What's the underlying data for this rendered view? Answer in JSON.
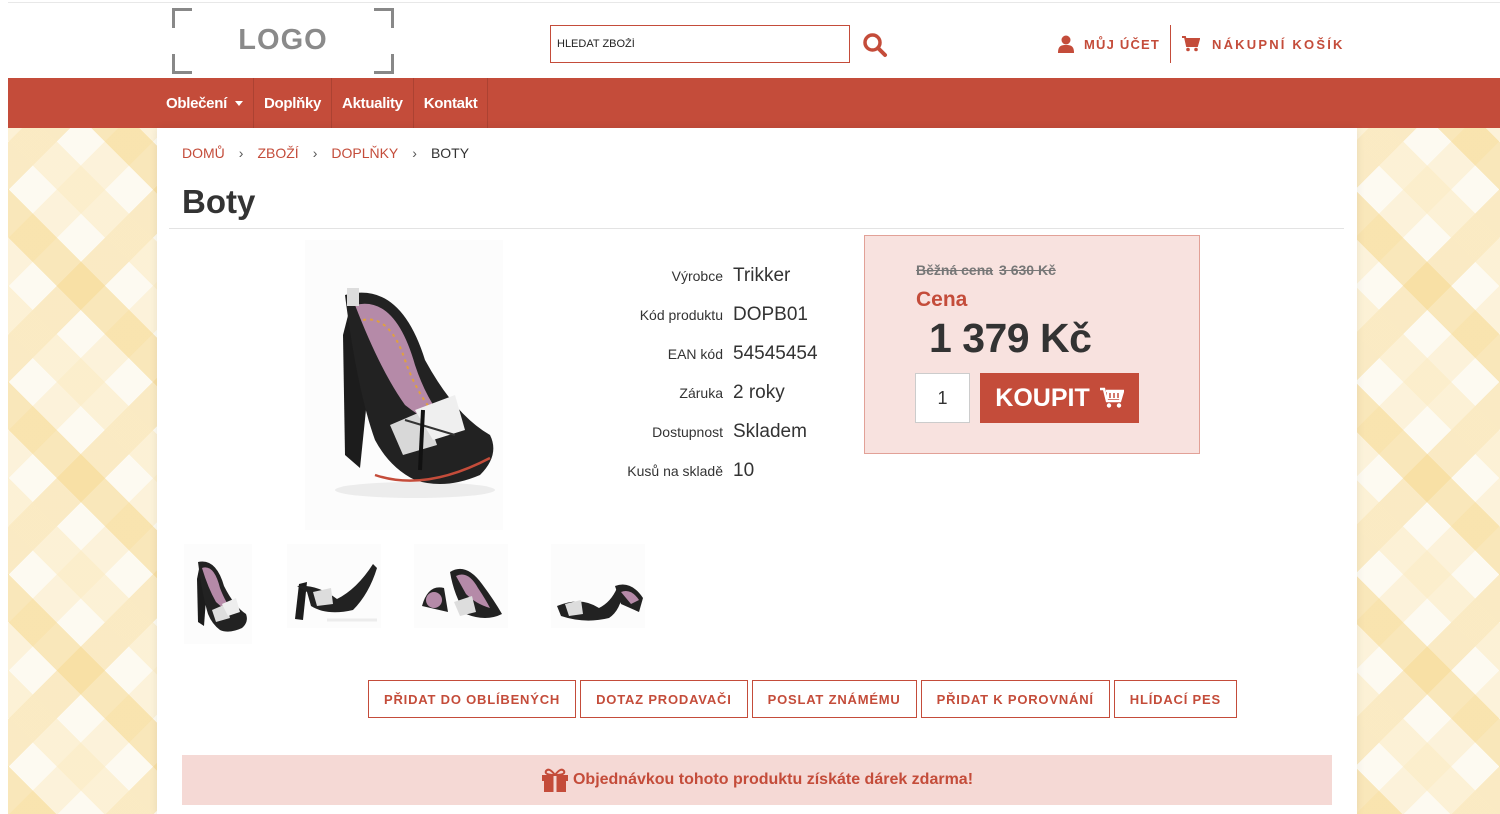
{
  "header": {
    "logo_text": "LOGO",
    "search_placeholder": "HLEDAT ZBOŽÍ",
    "account_label": "MŮJ ÚČET",
    "cart_label": "NÁKUPNÍ KOŠÍK"
  },
  "nav": {
    "items": [
      {
        "label": "Oblečení",
        "has_dropdown": true
      },
      {
        "label": "Doplňky"
      },
      {
        "label": "Aktuality"
      },
      {
        "label": "Kontakt"
      }
    ]
  },
  "breadcrumb": [
    "DOMŮ",
    "ZBOŽÍ",
    "DOPLŇKY",
    "BOTY"
  ],
  "product": {
    "title": "Boty",
    "specs": [
      {
        "label": "Výrobce",
        "value": "Trikker"
      },
      {
        "label": "Kód produktu",
        "value": "DOPB01"
      },
      {
        "label": "EAN kód",
        "value": "54545454"
      },
      {
        "label": "Záruka",
        "value": "2 roky"
      },
      {
        "label": "Dostupnost",
        "value": "Skladem"
      },
      {
        "label": "Kusů na skladě",
        "value": "10"
      }
    ],
    "old_price_label": "Běžná cena",
    "old_price": "3 630 Kč",
    "price_label": "Cena",
    "price": "1 379 Kč",
    "quantity": "1",
    "buy_label": "KOUPIT"
  },
  "actions": [
    "PŘIDAT DO OBLÍBENÝCH",
    "DOTAZ PRODAVAČI",
    "POSLAT ZNÁMÉMU",
    "PŘIDAT K POROVNÁNÍ",
    "HLÍDACÍ PES"
  ],
  "gift_text": "Objednávkou tohoto produktu získáte dárek zdarma!",
  "colors": {
    "accent": "#c44c3a",
    "pricebox_bg": "#f8e2df",
    "gift_bg": "#f5d9d5"
  }
}
